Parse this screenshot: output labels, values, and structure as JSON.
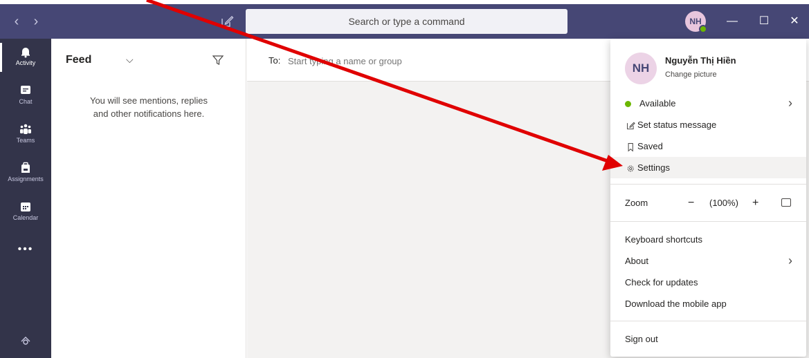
{
  "titlebar": {
    "back_glyph": "‹",
    "forward_glyph": "›",
    "search_placeholder": "Search or type a command",
    "avatar_initials": "NH",
    "minimize_glyph": "—",
    "maximize_glyph": "☐",
    "close_glyph": "✕"
  },
  "rail": {
    "items": [
      {
        "label": "Activity",
        "icon": "bell-icon"
      },
      {
        "label": "Chat",
        "icon": "chat-icon"
      },
      {
        "label": "Teams",
        "icon": "teams-icon"
      },
      {
        "label": "Assignments",
        "icon": "assignments-icon"
      },
      {
        "label": "Calendar",
        "icon": "calendar-icon"
      }
    ],
    "more_glyph": "•••"
  },
  "feed": {
    "title": "Feed",
    "chevron": "⌵",
    "empty_line1": "You will see mentions, replies",
    "empty_line2": "and other notifications here."
  },
  "compose": {
    "to_label": "To:",
    "to_placeholder": "Start typing a name or group"
  },
  "profile_menu": {
    "initials": "NH",
    "name": "Nguyễn Thị Hiền",
    "change_picture": "Change picture",
    "status": "Available",
    "set_status": "Set status message",
    "saved": "Saved",
    "settings": "Settings",
    "zoom_label": "Zoom",
    "zoom_minus": "−",
    "zoom_value": "(100%)",
    "zoom_plus": "+",
    "keyboard_shortcuts": "Keyboard shortcuts",
    "about": "About",
    "check_updates": "Check for updates",
    "download_mobile": "Download the mobile app",
    "sign_out": "Sign out",
    "chevron": "›"
  },
  "colors": {
    "titlebar": "#464775",
    "rail": "#33344a",
    "available": "#6bb700",
    "annotation_arrow": "#e00000"
  }
}
